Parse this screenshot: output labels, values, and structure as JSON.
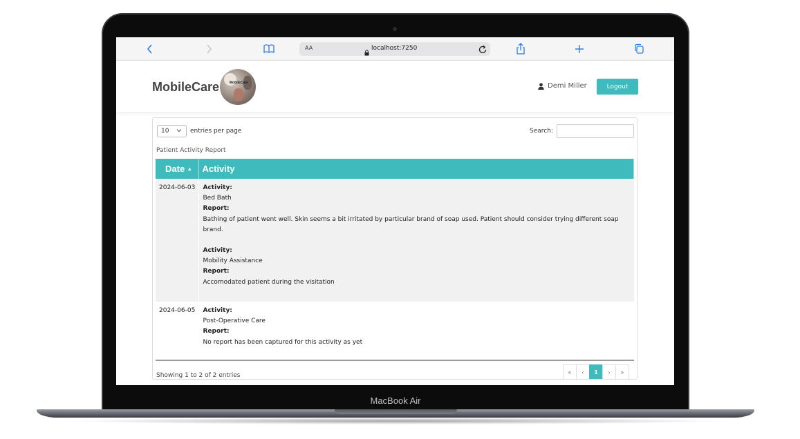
{
  "device": {
    "model_label": "MacBook Air"
  },
  "browser": {
    "text_size_label": "AA",
    "url": "localhost:7250",
    "icons": [
      "back-icon",
      "forward-icon",
      "bookmarks-icon",
      "lock-icon",
      "reload-icon",
      "share-icon",
      "new-tab-icon",
      "tabs-icon"
    ]
  },
  "header": {
    "brand": "MobileCare",
    "logo_text": "MobileCare",
    "user_name": "Demi Miller",
    "logout_label": "Logout"
  },
  "table_controls": {
    "page_length": "10",
    "entries_label": "entries per page",
    "search_label": "Search:",
    "search_value": ""
  },
  "report": {
    "caption": "Patient Activity Report",
    "columns": [
      "Date",
      "Activity"
    ],
    "activity_label": "Activity:",
    "report_label": "Report:",
    "rows": [
      {
        "date": "2024-06-03",
        "entries": [
          {
            "activity": "Bed Bath",
            "report": "Bathing of patient went well. Skin seems a bit irritated by particular brand of soap used. Patient should consider trying different soap brand."
          },
          {
            "activity": "Mobility Assistance",
            "report": "Accomodated patient during the visitation"
          }
        ]
      },
      {
        "date": "2024-06-05",
        "entries": [
          {
            "activity": "Post-Operative Care",
            "report": "No report has been captured for this activity as yet"
          }
        ]
      }
    ]
  },
  "footer": {
    "info": "Showing 1 to 2 of 2 entries",
    "pager": [
      "«",
      "‹",
      "1",
      "›",
      "»"
    ],
    "current_page": "1"
  },
  "colors": {
    "accent": "#3fbabd",
    "browser_blue": "#2b7de9"
  }
}
